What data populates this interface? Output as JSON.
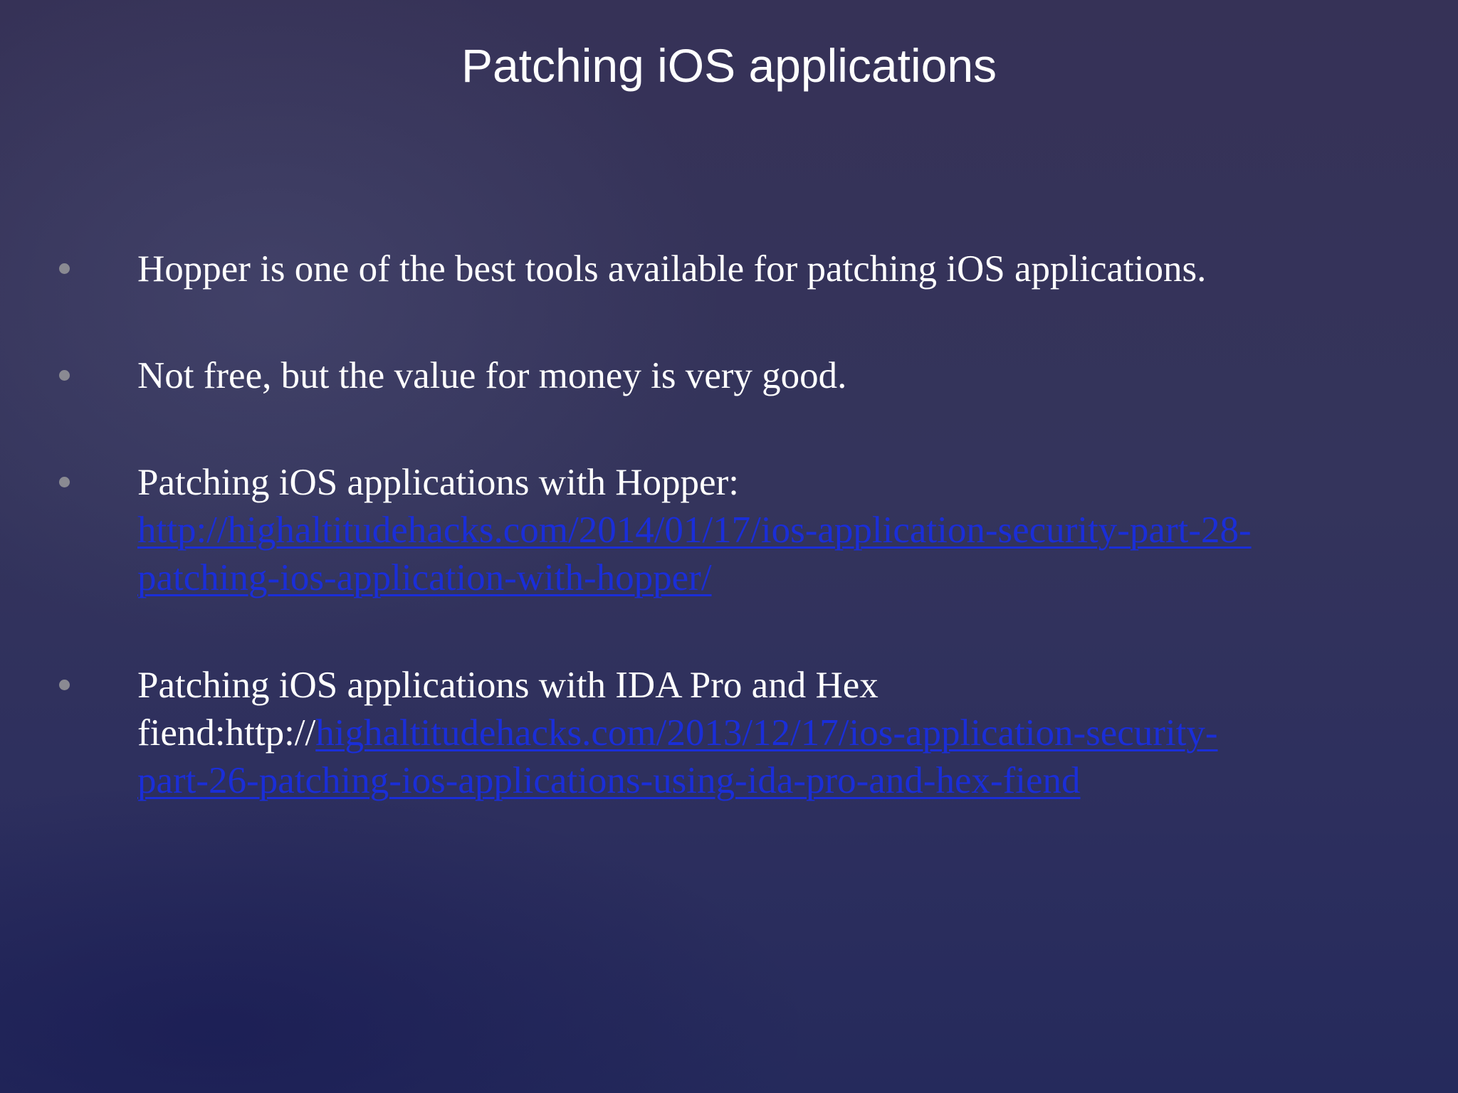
{
  "slide": {
    "title": "Patching iOS applications",
    "bullets": [
      {
        "lines": [
          {
            "text": "Hopper is one of the best tools available for patching iOS applications."
          }
        ]
      },
      {
        "lines": [
          {
            "text": "Not free, but the value for money is very good."
          }
        ]
      },
      {
        "lines": [
          {
            "text": "Patching iOS applications with Hopper:"
          },
          {
            "link": "http://highaltitudehacks.com/2014/01/17/ios-application-security-part-28-"
          },
          {
            "link": "patching-ios-application-with-hopper/"
          }
        ]
      },
      {
        "lines": [
          {
            "text": "Patching iOS applications with IDA Pro and Hex"
          },
          {
            "text": "fiend:http://",
            "link": "highaltitudehacks.com/2013/12/17/ios-application-security-"
          },
          {
            "link": "part-26-patching-ios-applications-using-ida-pro-and-hex-fiend"
          }
        ]
      }
    ]
  },
  "colors": {
    "title_text": "#ffffff",
    "body_text": "#ffffff",
    "link": "#1a2ed8",
    "bullet": "#8a8a92",
    "background_top": "#363257",
    "background_bottom": "#252a5c"
  }
}
